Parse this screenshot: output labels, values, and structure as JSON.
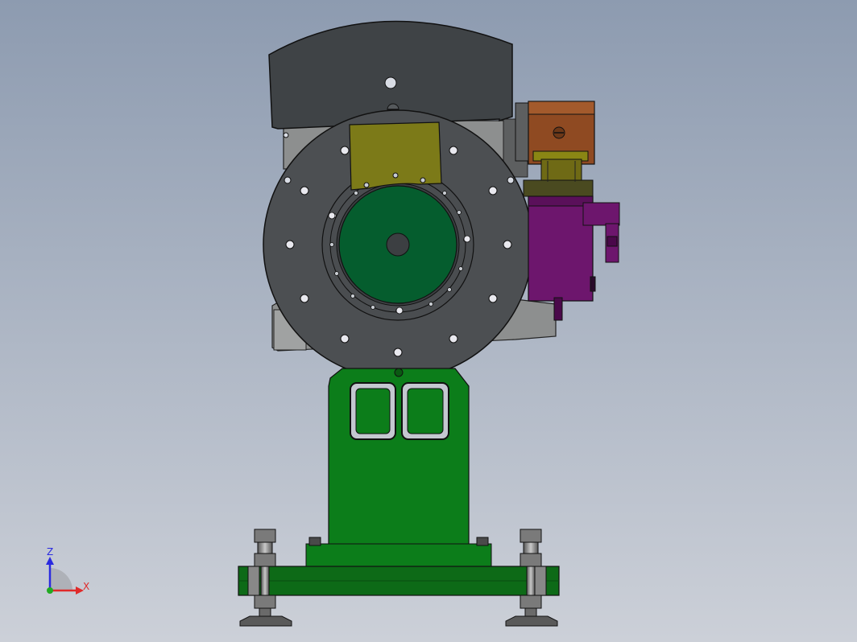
{
  "viewport": {
    "background_top": "#8d9bb0",
    "background_bottom": "#ccd0d8"
  },
  "triad": {
    "z_label": "Z",
    "x_label": "X",
    "z_color": "#2a2ae0",
    "x_color": "#e02a2a",
    "origin_color": "#22aa22"
  },
  "colors": {
    "hood": "#3f4346",
    "disc": "#4c4f52",
    "hub": "#055d2e",
    "bracket_yellow": "#7c7a18",
    "pedestal": "#0c7d1a",
    "motor_purple": "#6d166d",
    "gearbox_brown": "#8f4a22",
    "coupling": "#6f6a15",
    "housing_gray": "#8d8f8f",
    "base_bar": "#0d6a17",
    "steel": "#8a8a8a"
  }
}
